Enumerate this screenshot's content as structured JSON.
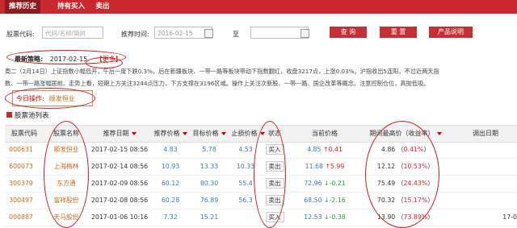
{
  "tabs": [
    {
      "label": "推荐历史",
      "active": true
    },
    {
      "label": "持有买入",
      "active": false
    },
    {
      "label": "卖出",
      "active": false
    }
  ],
  "search": {
    "code_label": "股票代码:",
    "code_placeholder": "代码/名称/简拼",
    "time_label": "推荐时间:",
    "date_from": "2016-02-15",
    "to_label": "至",
    "date_to": "",
    "query_btn": "查 询",
    "reset_btn": "重 置",
    "help_btn": "产品说明"
  },
  "news": {
    "label": "最新策略:",
    "date": "2017-02-15",
    "more": "【更多】",
    "line1": "周二（2月14日）上证指数小幅低开，午后一度下跌0.3%，后在新疆板块、一带一路等板块带动下指数翻红，收盘3217点，上涨0.03%。沪指收出5连阳，不过近两天指",
    "line2": "数、一带一路涨幅居前。走势上看，短期上方关注3244点压力，下方支撑在3196区域。操作上关注次新股、一带一路、国企改革等概念，注意控制仓位，高抛低吸。"
  },
  "today_op": {
    "label": "今日操作:",
    "value": "顺发恒业"
  },
  "pool_title": "股票池列表",
  "columns": [
    "股票代码",
    "股票名称",
    "推荐日期",
    "推荐价格",
    "目标价格",
    "止损价格",
    "状态",
    "当前价格",
    "期间最高价（收益率）",
    "调出日期"
  ],
  "rows": [
    {
      "code": "000631",
      "name": "顺发恒业",
      "date": "2017-02-15 08:56",
      "rec": "4.83",
      "target": "5.78",
      "stop": "4.53",
      "status": "买入",
      "cur": "4.85",
      "chg": "0.41",
      "chg_dir": "up",
      "high": "4.86",
      "ret": "0.41%",
      "out": ""
    },
    {
      "code": "600073",
      "name": "上海梅林",
      "date": "2017-02-14 08:56",
      "rec": "10.93",
      "target": "13.33",
      "stop": "10.33",
      "status": "卖出",
      "cur": "11.68",
      "chg": "5.99",
      "chg_dir": "up",
      "high": "12.12",
      "ret": "10.53%",
      "out": ""
    },
    {
      "code": "300379",
      "name": "东方通",
      "date": "2017-02-09 08:56",
      "rec": "60.12",
      "target": "80.30",
      "stop": "55.4",
      "status": "卖出",
      "cur": "72.96",
      "chg": "-0.21",
      "chg_dir": "down",
      "high": "75.49",
      "ret": "24.43%",
      "out": ""
    },
    {
      "code": "300497",
      "name": "富祥股份",
      "date": "2017-02-08 08:56",
      "rec": "60.28",
      "target": "76.89",
      "stop": "56.3",
      "status": "卖出",
      "cur": "68.50",
      "chg": "-2.16",
      "chg_dir": "down",
      "high": "70.32",
      "ret": "15.17%",
      "out": ""
    },
    {
      "code": "000887",
      "name": "天马股份",
      "date": "2017-01-06 10:16",
      "rec": "7.32",
      "target": "15.21",
      "stop": "",
      "status": "买入",
      "cur": "12.53",
      "chg": "-0.38",
      "chg_dir": "down",
      "high": "13.90",
      "ret": "73.89%",
      "out": "17-0"
    }
  ]
}
